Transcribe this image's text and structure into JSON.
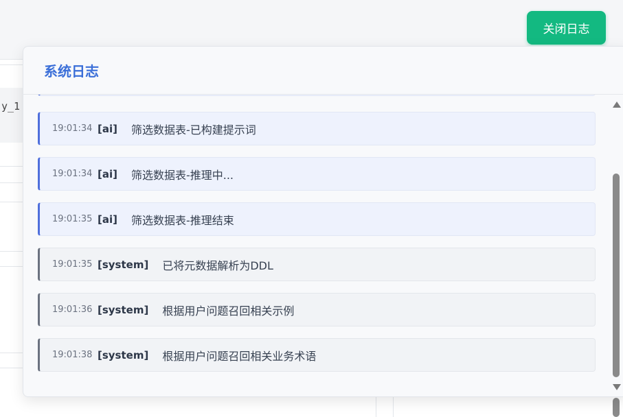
{
  "background": {
    "code_fragment": "y_1"
  },
  "toolbar": {
    "close_log_label": "关闭日志"
  },
  "log_panel": {
    "title": "系统日志",
    "entries": [
      {
        "time": "19:01:34",
        "type": "[ai]",
        "message": "筛选数据表-已构建提示词",
        "kind": "ai"
      },
      {
        "time": "19:01:34",
        "type": "[ai]",
        "message": "筛选数据表-推理中...",
        "kind": "ai"
      },
      {
        "time": "19:01:35",
        "type": "[ai]",
        "message": "筛选数据表-推理结束",
        "kind": "ai"
      },
      {
        "time": "19:01:35",
        "type": "[system]",
        "message": "已将元数据解析为DDL",
        "kind": "system"
      },
      {
        "time": "19:01:36",
        "type": "[system]",
        "message": "根据用户问题召回相关示例",
        "kind": "system"
      },
      {
        "time": "19:01:38",
        "type": "[system]",
        "message": "根据用户问题召回相关业务术语",
        "kind": "system"
      }
    ]
  },
  "colors": {
    "accent_green": "#13b981",
    "title_blue": "#3b6fd8",
    "ai_border": "#4f6fdc",
    "system_border": "#6b7280"
  }
}
